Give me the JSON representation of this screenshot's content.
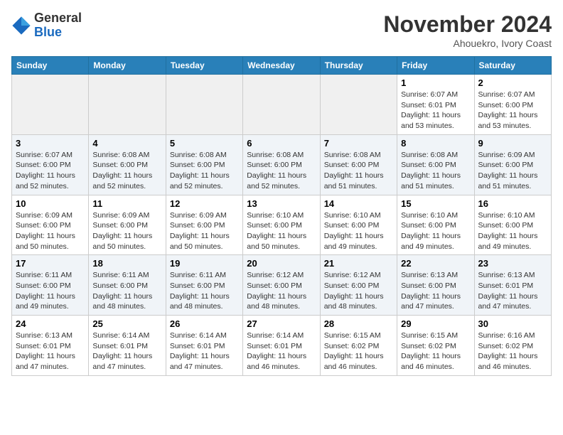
{
  "header": {
    "logo_general": "General",
    "logo_blue": "Blue",
    "month_title": "November 2024",
    "location": "Ahouekro, Ivory Coast"
  },
  "weekdays": [
    "Sunday",
    "Monday",
    "Tuesday",
    "Wednesday",
    "Thursday",
    "Friday",
    "Saturday"
  ],
  "weeks": [
    [
      {
        "day": "",
        "info": ""
      },
      {
        "day": "",
        "info": ""
      },
      {
        "day": "",
        "info": ""
      },
      {
        "day": "",
        "info": ""
      },
      {
        "day": "",
        "info": ""
      },
      {
        "day": "1",
        "info": "Sunrise: 6:07 AM\nSunset: 6:01 PM\nDaylight: 11 hours and 53 minutes."
      },
      {
        "day": "2",
        "info": "Sunrise: 6:07 AM\nSunset: 6:00 PM\nDaylight: 11 hours and 53 minutes."
      }
    ],
    [
      {
        "day": "3",
        "info": "Sunrise: 6:07 AM\nSunset: 6:00 PM\nDaylight: 11 hours and 52 minutes."
      },
      {
        "day": "4",
        "info": "Sunrise: 6:08 AM\nSunset: 6:00 PM\nDaylight: 11 hours and 52 minutes."
      },
      {
        "day": "5",
        "info": "Sunrise: 6:08 AM\nSunset: 6:00 PM\nDaylight: 11 hours and 52 minutes."
      },
      {
        "day": "6",
        "info": "Sunrise: 6:08 AM\nSunset: 6:00 PM\nDaylight: 11 hours and 52 minutes."
      },
      {
        "day": "7",
        "info": "Sunrise: 6:08 AM\nSunset: 6:00 PM\nDaylight: 11 hours and 51 minutes."
      },
      {
        "day": "8",
        "info": "Sunrise: 6:08 AM\nSunset: 6:00 PM\nDaylight: 11 hours and 51 minutes."
      },
      {
        "day": "9",
        "info": "Sunrise: 6:09 AM\nSunset: 6:00 PM\nDaylight: 11 hours and 51 minutes."
      }
    ],
    [
      {
        "day": "10",
        "info": "Sunrise: 6:09 AM\nSunset: 6:00 PM\nDaylight: 11 hours and 50 minutes."
      },
      {
        "day": "11",
        "info": "Sunrise: 6:09 AM\nSunset: 6:00 PM\nDaylight: 11 hours and 50 minutes."
      },
      {
        "day": "12",
        "info": "Sunrise: 6:09 AM\nSunset: 6:00 PM\nDaylight: 11 hours and 50 minutes."
      },
      {
        "day": "13",
        "info": "Sunrise: 6:10 AM\nSunset: 6:00 PM\nDaylight: 11 hours and 50 minutes."
      },
      {
        "day": "14",
        "info": "Sunrise: 6:10 AM\nSunset: 6:00 PM\nDaylight: 11 hours and 49 minutes."
      },
      {
        "day": "15",
        "info": "Sunrise: 6:10 AM\nSunset: 6:00 PM\nDaylight: 11 hours and 49 minutes."
      },
      {
        "day": "16",
        "info": "Sunrise: 6:10 AM\nSunset: 6:00 PM\nDaylight: 11 hours and 49 minutes."
      }
    ],
    [
      {
        "day": "17",
        "info": "Sunrise: 6:11 AM\nSunset: 6:00 PM\nDaylight: 11 hours and 49 minutes."
      },
      {
        "day": "18",
        "info": "Sunrise: 6:11 AM\nSunset: 6:00 PM\nDaylight: 11 hours and 48 minutes."
      },
      {
        "day": "19",
        "info": "Sunrise: 6:11 AM\nSunset: 6:00 PM\nDaylight: 11 hours and 48 minutes."
      },
      {
        "day": "20",
        "info": "Sunrise: 6:12 AM\nSunset: 6:00 PM\nDaylight: 11 hours and 48 minutes."
      },
      {
        "day": "21",
        "info": "Sunrise: 6:12 AM\nSunset: 6:00 PM\nDaylight: 11 hours and 48 minutes."
      },
      {
        "day": "22",
        "info": "Sunrise: 6:13 AM\nSunset: 6:00 PM\nDaylight: 11 hours and 47 minutes."
      },
      {
        "day": "23",
        "info": "Sunrise: 6:13 AM\nSunset: 6:01 PM\nDaylight: 11 hours and 47 minutes."
      }
    ],
    [
      {
        "day": "24",
        "info": "Sunrise: 6:13 AM\nSunset: 6:01 PM\nDaylight: 11 hours and 47 minutes."
      },
      {
        "day": "25",
        "info": "Sunrise: 6:14 AM\nSunset: 6:01 PM\nDaylight: 11 hours and 47 minutes."
      },
      {
        "day": "26",
        "info": "Sunrise: 6:14 AM\nSunset: 6:01 PM\nDaylight: 11 hours and 47 minutes."
      },
      {
        "day": "27",
        "info": "Sunrise: 6:14 AM\nSunset: 6:01 PM\nDaylight: 11 hours and 46 minutes."
      },
      {
        "day": "28",
        "info": "Sunrise: 6:15 AM\nSunset: 6:02 PM\nDaylight: 11 hours and 46 minutes."
      },
      {
        "day": "29",
        "info": "Sunrise: 6:15 AM\nSunset: 6:02 PM\nDaylight: 11 hours and 46 minutes."
      },
      {
        "day": "30",
        "info": "Sunrise: 6:16 AM\nSunset: 6:02 PM\nDaylight: 11 hours and 46 minutes."
      }
    ]
  ]
}
